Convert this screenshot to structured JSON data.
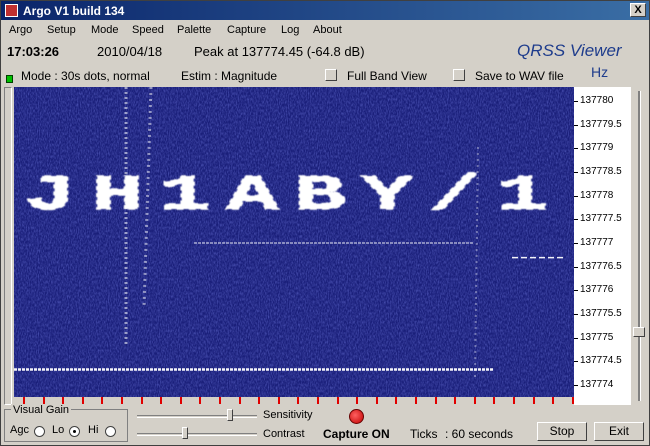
{
  "window": {
    "title": "Argo  V1 build 134",
    "close_label": "X"
  },
  "menu": [
    "Argo",
    "Setup",
    "Mode",
    "Speed",
    "Palette",
    "Capture",
    "Log",
    "About"
  ],
  "info": {
    "time": "17:03:26",
    "date": "2010/04/18",
    "peak": "Peak at 137774.45 (-64.8 dB)",
    "brand": "QRSS Viewer",
    "unit": "Hz"
  },
  "status": {
    "mode": "Mode : 30s dots, normal",
    "estim": "Estim : Magnitude",
    "full_band": "Full Band View",
    "save_wav": "Save to WAV file"
  },
  "spectrogram": {
    "callsign": "JH1ABY/1",
    "trace_freqs_hz": [
      137777,
      137776.7,
      137774.4
    ],
    "freq_axis": [
      "137780",
      "137779.5",
      "137779",
      "137778.5",
      "137778",
      "137777.5",
      "137777",
      "137776.5",
      "137776",
      "137775.5",
      "137775",
      "137774.5",
      "137774"
    ],
    "colors": {
      "background": "#1a1f7a",
      "signal": "#ffffff"
    }
  },
  "controls": {
    "visual_gain": "Visual Gain",
    "agc": "Agc",
    "lo": "Lo",
    "hi": "Hi",
    "sensitivity": "Sensitivity",
    "contrast": "Contrast",
    "capture": "Capture ON",
    "ticks": "Ticks",
    "ticks_value": ": 60 seconds",
    "stop": "Stop",
    "exit": "Exit"
  }
}
